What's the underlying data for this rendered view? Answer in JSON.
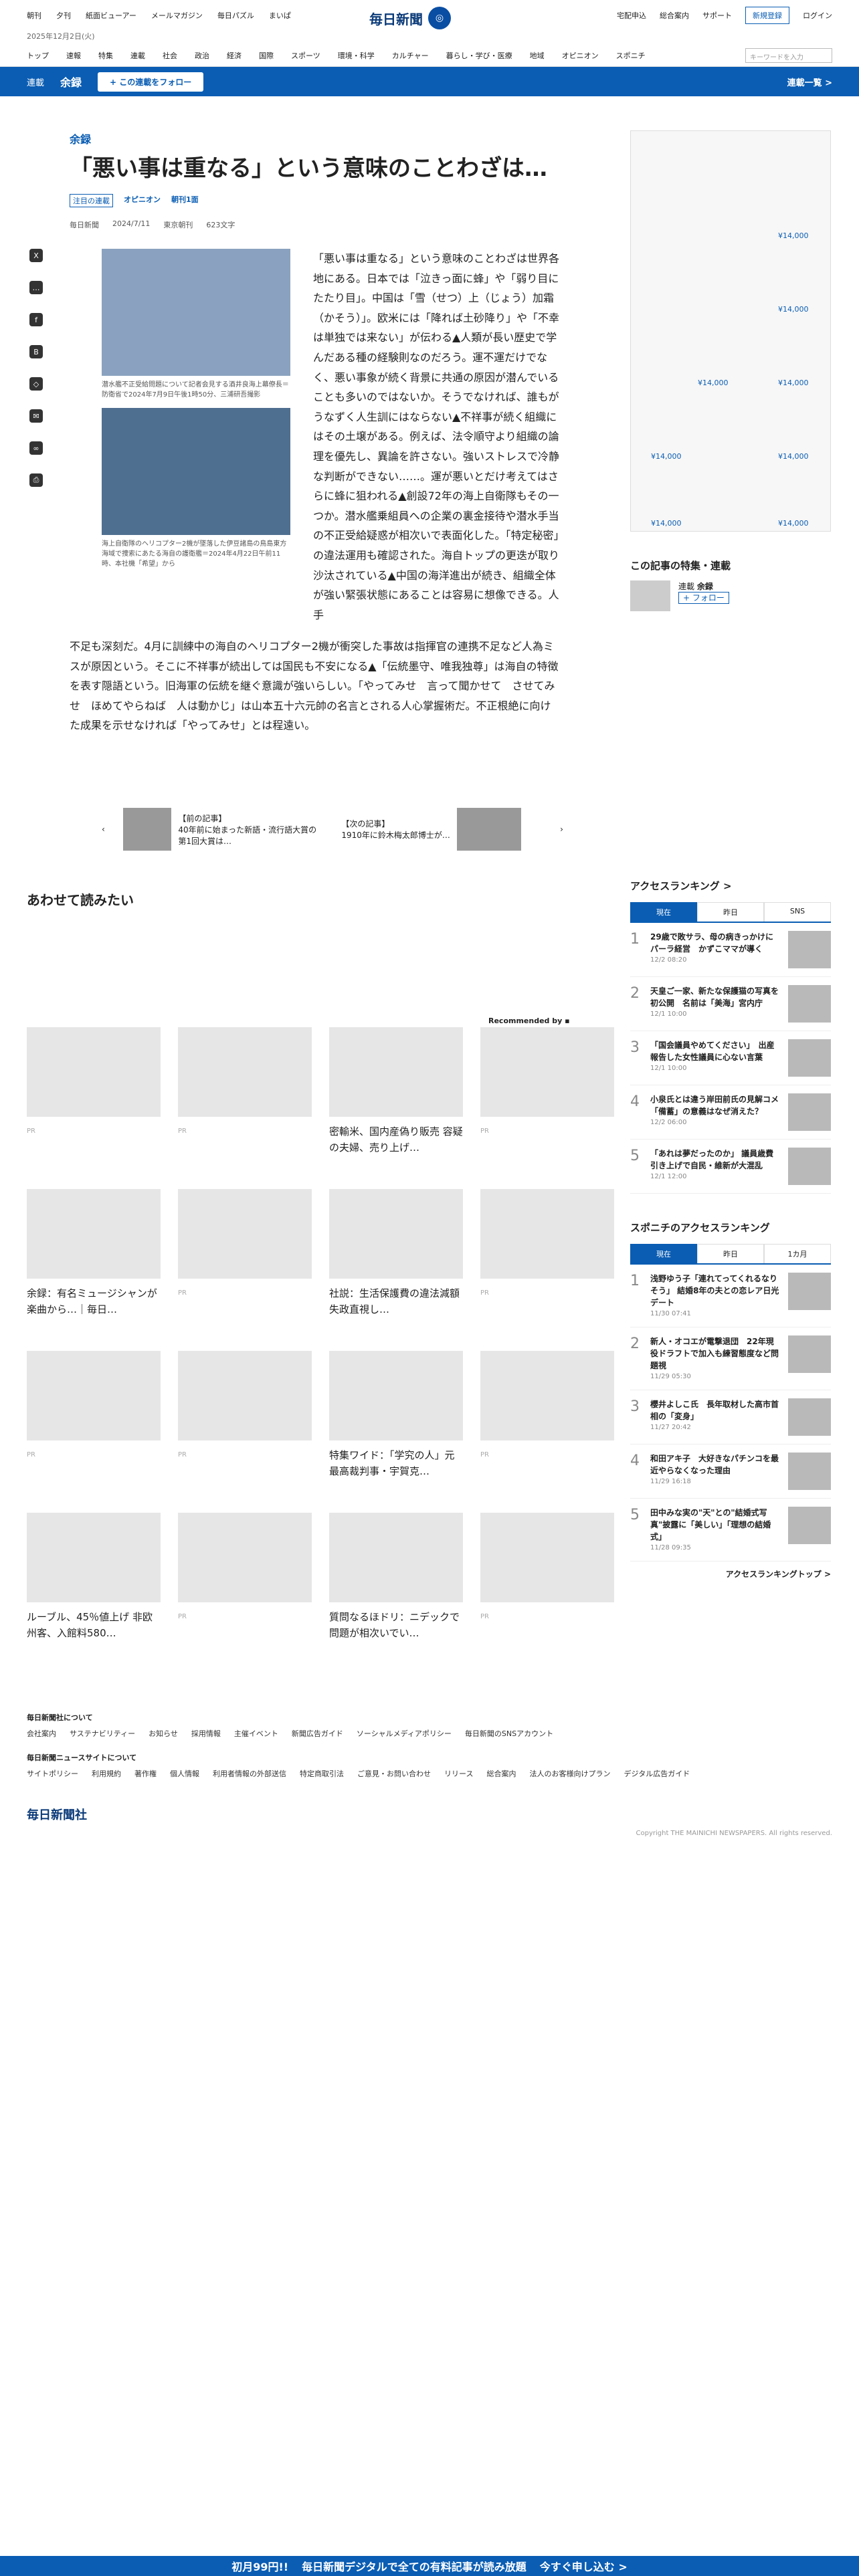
{
  "header": {
    "left_links": [
      "朝刊",
      "夕刊",
      "紙面ビューアー",
      "メールマガジン",
      "毎日パズル",
      "まいぱ"
    ],
    "date": "2025年12月2日(火)",
    "logo": "毎日新聞",
    "right_links": [
      "宅配申込",
      "総合案内",
      "サポート"
    ],
    "register": "新規登録",
    "login": "ログイン"
  },
  "nav": {
    "items": [
      "トップ",
      "速報",
      "特集",
      "連載",
      "社会",
      "政治",
      "経済",
      "国際",
      "スポーツ",
      "環境・科学",
      "カルチャー",
      "暮らし・学び・医療",
      "地域",
      "オピニオン",
      "スポニチ"
    ],
    "search_placeholder": "キーワードを入力"
  },
  "series": {
    "label": "連載",
    "name": "余録",
    "follow": "+ この連載をフォロー",
    "list": "連載一覧 >"
  },
  "article": {
    "kicker": "余録",
    "title": "「悪い事は重なる」という意味のことわざは…",
    "tags": [
      "注目の連載",
      "オピニオン",
      "朝刊1面"
    ],
    "meta": [
      "毎日新聞",
      "2024/7/11",
      "東京朝刊",
      "623文字"
    ],
    "cap1": "潜水艦不正受給問題について記者会見する酒井良海上幕僚長＝防衛省で2024年7月9日午後1時50分、三浦研吾撮影",
    "cap2": "海上自衛隊のヘリコプター2機が墜落した伊豆諸島の鳥島東方海域で捜索にあたる海自の護衛艦＝2024年4月22日午前11時、本社機「希望」から",
    "body": "「悪い事は重なる」という意味のことわざは世界各地にある。日本では「泣きっ面に蜂」や「弱り目にたたり目」。中国は「雪（せつ）上（じょう）加霜（かそう）」。欧米には「降れば土砂降り」や「不幸は単独では来ない」が伝わる▲人類が長い歴史で学んだある種の経験則なのだろう。運不運だけでなく、悪い事象が続く背景に共通の原因が潜んでいることも多いのではないか。そうでなければ、誰もがうなずく人生訓にはならない▲不祥事が続く組織にはその土壌がある。例えば、法令順守より組織の論理を優先し、異論を許さない。強いストレスで冷静な判断ができない……。運が悪いとだけ考えてはさらに蜂に狙われる▲創設72年の海上自衛隊もその一つか。潜水艦乗組員への企業の裏金接待や潜水手当の不正受給疑惑が相次いで表面化した。「特定秘密」の違法運用も確認された。海自トップの更迭が取り沙汰されている▲中国の海洋進出が続き、組織全体が強い緊張状態にあることは容易に想像できる。人手",
    "body2": "不足も深刻だ。4月に訓練中の海自のヘリコプター2機が衝突した事故は指揮官の連携不足など人為ミスが原因という。そこに不祥事が続出しては国民も不安になる▲「伝統墨守、唯我独尊」は海自の特徴を表す隠語という。旧海軍の伝統を継ぐ意識が強いらしい。「やってみせ　言って聞かせて　させてみせ　ほめてやらねば　人は動かじ」は山本五十六元帥の名言とされる人心掌握術だ。不正根絶に向けた成果を示せなければ「やってみせ」とは程遠い。",
    "prev_label": "【前の記事】",
    "prev": "40年前に始まった新語・流行語大賞の第1回大賞は…",
    "next_label": "【次の記事】",
    "next": "1910年に鈴木梅太郎博士が…"
  },
  "related": {
    "title": "あわせて読みたい",
    "recommended": "Recommended by",
    "cards": [
      "",
      "",
      "密輸米、国内産偽り販売 容疑の夫婦、売り上げ…",
      "",
      "余録：有名ミュージシャンが楽曲から…｜毎日…",
      "",
      "社説：生活保護費の違法減額　失政直視し…",
      "",
      "",
      "",
      "特集ワイド：「学究の人」元最高裁判事・宇賀克…",
      "",
      "ルーブル、45％値上げ 非欧州客、入館料580…",
      "",
      "質問なるほドリ：ニデックで問題が相次いでい…",
      ""
    ],
    "pr": "PR"
  },
  "sidebar": {
    "ad_price": "¥14,000",
    "follow_title": "この記事の特集・連載",
    "follow_series_label": "連載",
    "follow_series": "余録",
    "follow_btn": "+ フォロー",
    "ranking_title": "アクセスランキング >",
    "tabs": [
      "現在",
      "昨日",
      "SNS"
    ],
    "ranks": [
      {
        "t": "29歳で敗サラ、母の病きっかけにパーラ経営　かずこママが導く",
        "d": "12/2 08:20"
      },
      {
        "t": "天皇ご一家、新たな保護猫の写真を初公開　名前は「美海」宮内庁",
        "d": "12/1 10:00"
      },
      {
        "t": "「国会議員やめてください」　出産報告した女性議員に心ない言葉",
        "d": "12/1 10:00"
      },
      {
        "t": "小泉氏とは違う岸田前氏の見解コメ「備蓄」の意義はなぜ消えた？",
        "d": "12/2 06:00"
      },
      {
        "t": "「あれは夢だったのか」 議員歳費引き上げで自民・維新が大混乱",
        "d": "12/1 12:00"
      }
    ],
    "sponichi_title": "スポニチのアクセスランキング",
    "sponichi_tabs": [
      "現在",
      "昨日",
      "1カ月"
    ],
    "sranks": [
      {
        "t": "浅野ゆう子「連れてってくれるなりそう」 結婚8年の夫との恋レア日光デート",
        "d": "11/30 07:41"
      },
      {
        "t": "新人・オコエが電撃退団　22年現役ドラフトで加入も練習態度など問題視",
        "d": "11/29 05:30"
      },
      {
        "t": "櫻井よしこ氏　長年取材した高市首相の「変身」",
        "d": "11/27 20:42"
      },
      {
        "t": "和田アキ子　大好きなパチンコを最近やらなくなった理由",
        "d": "11/29 16:18"
      },
      {
        "t": "田中みな実の\"天\"との\"結婚式写真\"披露に「美しい」「理想の結婚式」",
        "d": "11/28 09:35"
      }
    ],
    "more": "アクセスランキングトップ >"
  },
  "footer": {
    "about": "毎日新聞社について",
    "about_links": [
      "会社案内",
      "サステナビリティー",
      "お知らせ",
      "採用情報",
      "主催イベント",
      "新聞広告ガイド",
      "ソーシャルメディアポリシー",
      "毎日新聞のSNSアカウント"
    ],
    "site": "毎日新聞ニュースサイトについて",
    "site_links": [
      "サイトポリシー",
      "利用規約",
      "著作権",
      "個人情報",
      "利用者情報の外部送信",
      "特定商取引法",
      "ご意見・お問い合わせ",
      "リリース",
      "総合案内",
      "法人のお客様向けプラン",
      "デジタル広告ガイド"
    ],
    "company": "毎日新聞社",
    "copyright": "Copyright THE MAINICHI NEWSPAPERS. All rights reserved."
  },
  "banner": {
    "price": "初月99円!!",
    "text": "毎日新聞デジタルで全ての有料記事が読み放題",
    "cta": "今すぐ申し込む >"
  }
}
